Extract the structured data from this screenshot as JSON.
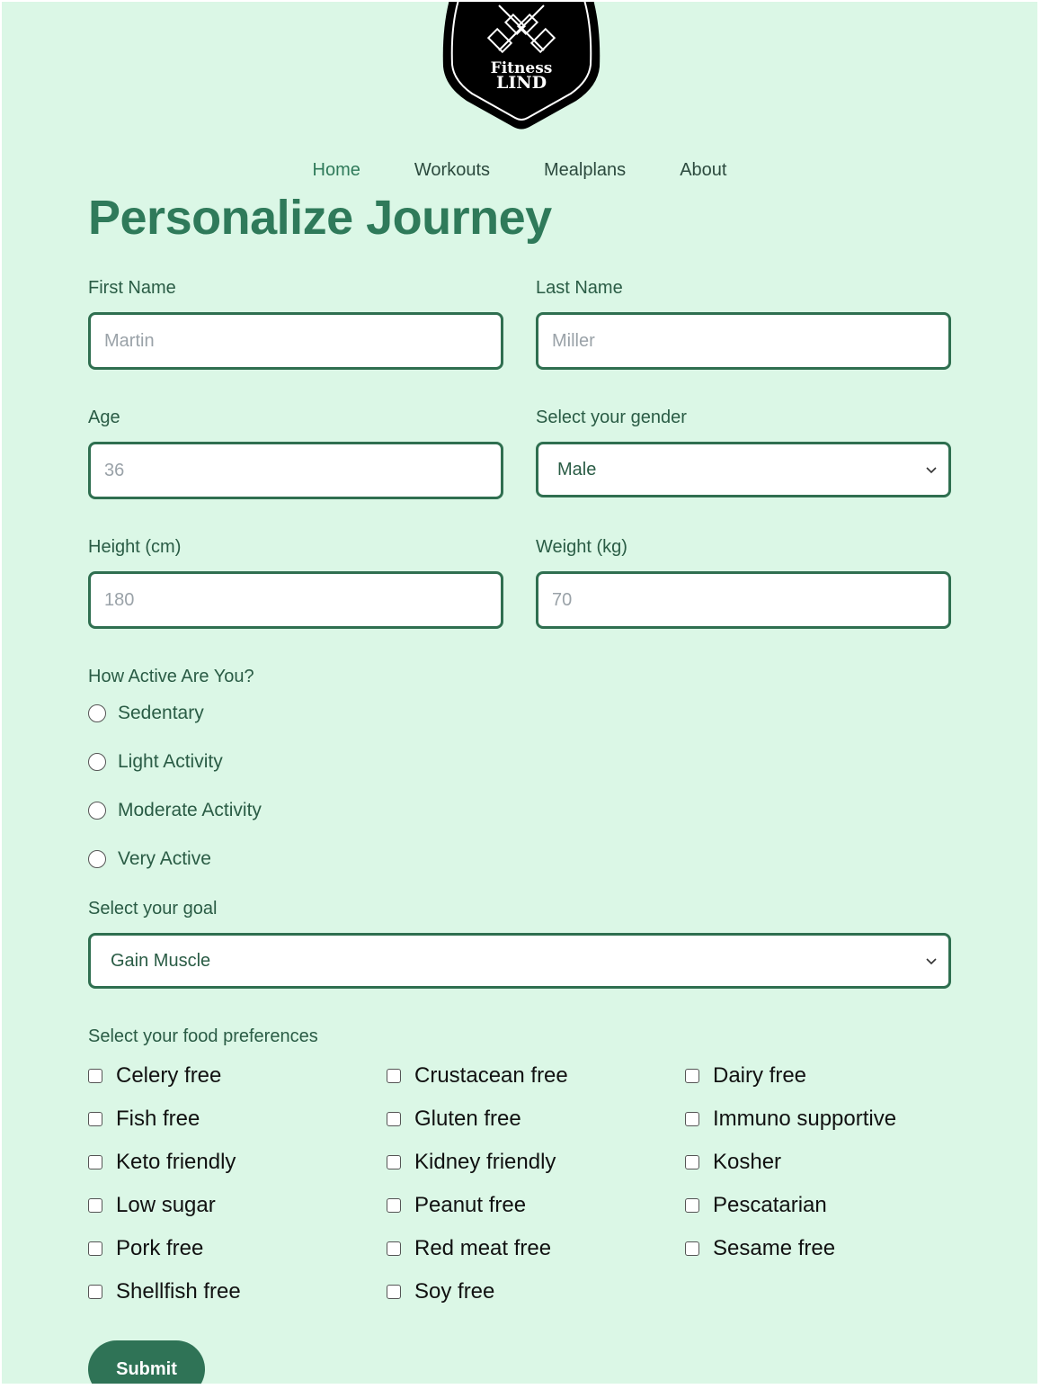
{
  "logo": {
    "line1": "Fitness",
    "line2": "LIND",
    "icon": "crossed-dumbbells-icon"
  },
  "nav": {
    "items": [
      {
        "label": "Home",
        "active": true
      },
      {
        "label": "Workouts",
        "active": false
      },
      {
        "label": "Mealplans",
        "active": false
      },
      {
        "label": "About",
        "active": false
      }
    ]
  },
  "title": "Personalize Journey",
  "form": {
    "first_name": {
      "label": "First Name",
      "placeholder": "Martin"
    },
    "last_name": {
      "label": "Last Name",
      "placeholder": "Miller"
    },
    "age": {
      "label": "Age",
      "placeholder": "36"
    },
    "gender": {
      "label": "Select your gender",
      "value": "Male"
    },
    "height": {
      "label": "Height (cm)",
      "placeholder": "180"
    },
    "weight": {
      "label": "Weight (kg)",
      "placeholder": "70"
    },
    "activity": {
      "label": "How Active Are You?",
      "options": [
        "Sedentary",
        "Light Activity",
        "Moderate Activity",
        "Very Active"
      ]
    },
    "goal": {
      "label": "Select your goal",
      "value": "Gain Muscle"
    },
    "food": {
      "label": "Select your food preferences",
      "options": [
        "Celery free",
        "Crustacean free",
        "Dairy free",
        "Fish free",
        "Gluten free",
        "Immuno supportive",
        "Keto friendly",
        "Kidney friendly",
        "Kosher",
        "Low sugar",
        "Peanut free",
        "Pescatarian",
        "Pork free",
        "Red meat free",
        "Sesame free",
        "Shellfish free",
        "Soy free"
      ]
    },
    "submit_label": "Submit"
  },
  "colors": {
    "background": "#dbf7e6",
    "accent": "#2f7a5a",
    "border": "#2f6f50",
    "button": "#2f7356"
  }
}
